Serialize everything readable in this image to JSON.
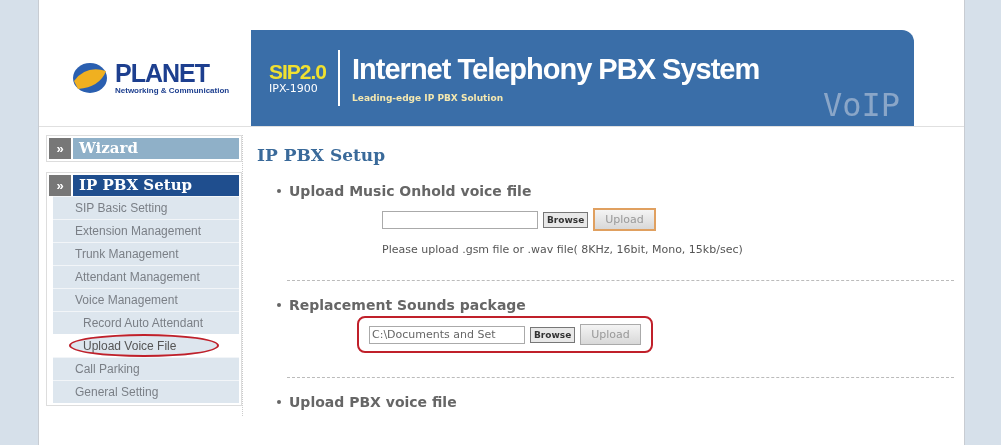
{
  "logo": {
    "name": "PLANET",
    "tagline": "Networking & Communication"
  },
  "banner": {
    "badge": "SIP2.0",
    "model": "IPX-1900",
    "title": "Internet Telephony PBX System",
    "subtitle": "Leading-edge IP PBX Solution",
    "mark": "VoIP"
  },
  "sidebar": {
    "groups": [
      {
        "icon": "»",
        "label": "Wizard",
        "selected": false
      },
      {
        "icon": "»",
        "label": "IP PBX Setup",
        "selected": true,
        "items": [
          {
            "label": "SIP Basic Setting",
            "highlighted": false
          },
          {
            "label": "Extension Management",
            "highlighted": false
          },
          {
            "label": "Trunk Management",
            "highlighted": false
          },
          {
            "label": "Attendant Management",
            "highlighted": false
          },
          {
            "label": "Voice Management",
            "highlighted": false,
            "children": [
              {
                "label": "Record Auto Attendant",
                "highlighted": false
              },
              {
                "label": "Upload Voice File",
                "highlighted": true
              }
            ]
          },
          {
            "label": "Call Parking",
            "highlighted": false
          },
          {
            "label": "General Setting",
            "highlighted": false
          }
        ]
      }
    ]
  },
  "main": {
    "heading": "IP PBX Setup",
    "sections": [
      {
        "title": "Upload Music Onhold voice file",
        "browse": "Browse",
        "upload": "Upload",
        "upload_focused": true,
        "note": "Please upload .gsm file or .wav file( 8KHz, 16bit, Mono, 15kb/sec)"
      },
      {
        "title": "Replacement Sounds package",
        "highlighted": true,
        "file_value": "C:\\Documents and Set",
        "browse": "Browse",
        "upload": "Upload",
        "upload_focused": false
      },
      {
        "title": "Upload PBX voice file"
      }
    ]
  }
}
